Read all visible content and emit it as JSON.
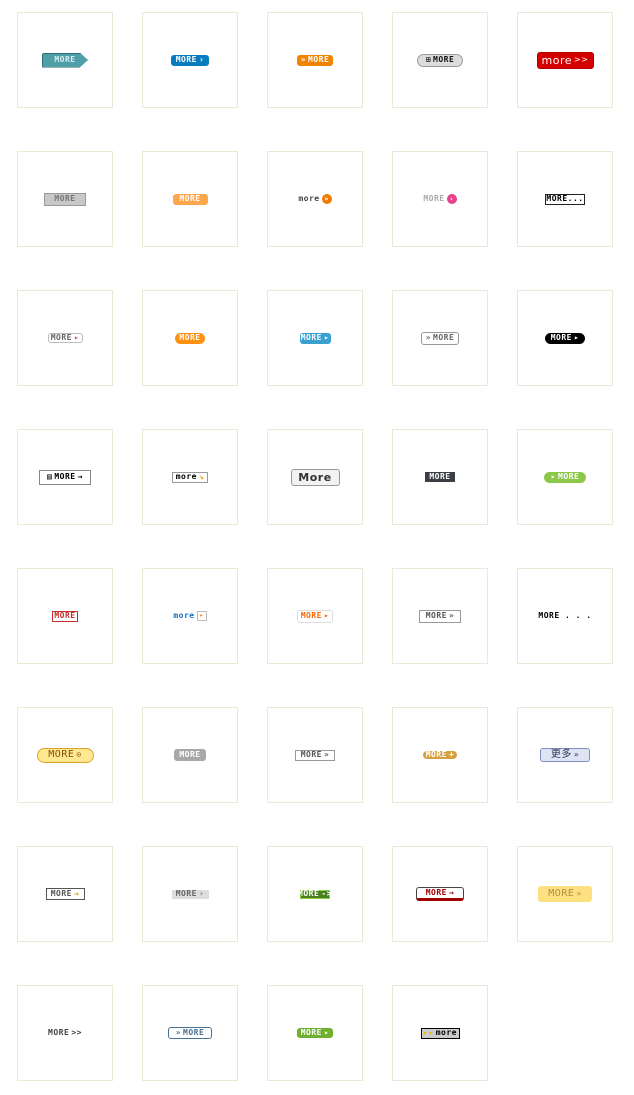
{
  "buttons": [
    {
      "label": "MORE",
      "bg": "#4f9ea8",
      "fg": "#d8eef0",
      "border": "#2f6e78",
      "shape": "tag"
    },
    {
      "label": "MORE",
      "suffix": "›",
      "bg": "#0a7bbf",
      "fg": "#ffffff",
      "border": "#0a7bbf",
      "shape": "rounded"
    },
    {
      "prefix": "»",
      "label": "MORE",
      "bg": "#f08300",
      "fg": "#ffffff",
      "border": "#f08300",
      "shape": "rounded"
    },
    {
      "prefix": "⊞",
      "label": "MORE",
      "bg": "#dcdcdc",
      "fg": "#111111",
      "border": "#999999",
      "shape": "pill"
    },
    {
      "label": "more",
      "suffix": ">>",
      "bg": "#d40000",
      "fg": "#ffffff",
      "border": "#b00000",
      "shape": "rounded"
    },
    {
      "label": "MORE",
      "bg": "#c8c8c8",
      "fg": "#777777",
      "border": "#999999",
      "shape": "rect"
    },
    {
      "label": "MORE",
      "bg": "#ffa54a",
      "fg": "#ffffff",
      "border": "#ffa54a",
      "shape": "rounded"
    },
    {
      "label": "more",
      "circle": "»",
      "circle_color": "#f07800",
      "fg": "#444444",
      "shape": "plain"
    },
    {
      "label": "MORE",
      "circle": "›",
      "circle_color": "#e8408a",
      "fg": "#aaaaaa",
      "shape": "plain"
    },
    {
      "label": "MORE...",
      "bg": "#ffffff",
      "fg": "#000000",
      "border": "#222222",
      "shape": "rect"
    },
    {
      "label": "MORE",
      "suffix": "▸",
      "suffix_color": "#e8408a",
      "bg": "#ffffff",
      "fg": "#666666",
      "border": "#bbbbbb",
      "shape": "rounded"
    },
    {
      "label": "MORE",
      "bg": "#ff9010",
      "fg": "#ffffff",
      "border": "#ff9010",
      "shape": "pill"
    },
    {
      "label": "MORE",
      "suffix": "▸",
      "bg": "#3aa0d0",
      "fg": "#ffffff",
      "border": "#3aa0d0",
      "shape": "rounded"
    },
    {
      "prefix": "»",
      "label": "MORE",
      "bg": "#ffffff",
      "fg": "#666666",
      "border": "#999999",
      "shape": "rounded"
    },
    {
      "label": "MORE",
      "suffix": "▸",
      "bg": "#000000",
      "fg": "#ffffff",
      "border": "#000000",
      "shape": "pill"
    },
    {
      "prefix": "▤",
      "label": "MORE",
      "suffix": "→",
      "bg": "#ffffff",
      "fg": "#000000",
      "border": "#888888",
      "shape": "rect"
    },
    {
      "label": "more",
      "suffix": "↘",
      "suffix_color": "#e0a000",
      "bg": "#ffffff",
      "fg": "#000000",
      "border": "#999999",
      "shape": "rect"
    },
    {
      "label": "More",
      "bg": "#f2f2f2",
      "fg": "#333333",
      "border": "#999999",
      "shape": "rounded"
    },
    {
      "label": "MORE",
      "bg": "#3b3f44",
      "fg": "#ffffff",
      "border": "#3b3f44",
      "shape": "rect"
    },
    {
      "prefix": "▸",
      "label": "MORE",
      "bg": "#8cc84a",
      "fg": "#ffffff",
      "border": "#8cc84a",
      "shape": "pill"
    },
    {
      "label": "MORE",
      "bg": "#ffffff",
      "fg": "#c03030",
      "border": "#c03030",
      "shape": "rect"
    },
    {
      "label": "more",
      "box": "▸",
      "box_color": "#ff6600",
      "fg": "#1070c0",
      "shape": "plain"
    },
    {
      "label": "MORE",
      "suffix": "▸",
      "bg": "#ffffff",
      "fg": "#ff6600",
      "border": "#dddddd",
      "shape": "rounded"
    },
    {
      "label": "MORE",
      "suffix": "»",
      "bg": "#ffffff",
      "fg": "#555555",
      "border": "#999999",
      "shape": "rect"
    },
    {
      "label": "MORE . . .",
      "fg": "#000000",
      "shape": "plain"
    },
    {
      "label": "MORE",
      "suffix": "⊙",
      "bg": "#ffe890",
      "fg": "#805000",
      "border": "#e0a030",
      "shape": "pill"
    },
    {
      "label": "MORE",
      "bg": "#a8a8a8",
      "fg": "#ffffff",
      "border": "#a8a8a8",
      "shape": "rounded"
    },
    {
      "label": "MORE",
      "suffix": "»",
      "bg": "#ffffff",
      "fg": "#555555",
      "border": "#999999",
      "shape": "rect"
    },
    {
      "label": "MORE",
      "suffix": "+",
      "bg": "#d4a040",
      "fg": "#ffffff",
      "border": "#d4a040",
      "shape": "pill"
    },
    {
      "label": "更多",
      "suffix": "»",
      "bg": "#dde4f4",
      "fg": "#333355",
      "border": "#8090c0",
      "shape": "rounded"
    },
    {
      "label": "MORE",
      "suffix": "→",
      "suffix_color": "#f09000",
      "bg": "#ffffff",
      "fg": "#555555",
      "border": "#555555",
      "shape": "rect"
    },
    {
      "label": "MORE",
      "suffix": "›",
      "suffix_color": "#3a90c0",
      "bg": "#dddddd",
      "fg": "#666666",
      "border": "#dddddd",
      "shape": "rect"
    },
    {
      "label": "MORE",
      "suffix": "->",
      "bg": "#4a8020",
      "fg": "#ffffff",
      "border": "#88cc44",
      "shape": "rect"
    },
    {
      "label": "MORE",
      "suffix": "→",
      "bg": "#ffffff",
      "fg": "#a00000",
      "border": "#444444",
      "shape": "rounded"
    },
    {
      "label": "MORE",
      "suffix": "»",
      "bg": "#fde080",
      "fg": "#b09040",
      "border": "#fde080",
      "shape": "rounded"
    },
    {
      "label": "MORE",
      "suffix": ">>",
      "fg": "#444444",
      "shape": "plain"
    },
    {
      "prefix": "»",
      "label": "MORE",
      "bg": "#ffffff",
      "fg": "#4a7090",
      "border": "#4a7090",
      "shape": "rounded"
    },
    {
      "label": "MORE",
      "suffix": "▸",
      "bg": "#70b030",
      "fg": "#ffffff",
      "border": "#70b030",
      "shape": "rounded"
    },
    {
      "prefix": "▸▸",
      "prefix_color": "#f0b000",
      "label": "more",
      "bg": "#cccccc",
      "fg": "#000000",
      "border": "#000000",
      "shape": "rect"
    }
  ]
}
